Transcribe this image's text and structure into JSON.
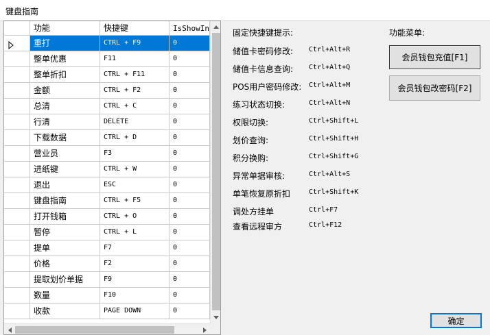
{
  "window": {
    "title": "键盘指南"
  },
  "grid": {
    "columns": [
      "功能",
      "快捷键",
      "IsShowInM"
    ],
    "selected_index": 0,
    "rows": [
      {
        "name": "重打",
        "key": "CTRL + F9",
        "show": "0"
      },
      {
        "name": "整单优惠",
        "key": "F11",
        "show": "0"
      },
      {
        "name": "整单折扣",
        "key": "CTRL + F11",
        "show": "0"
      },
      {
        "name": "金额",
        "key": "CTRL + F2",
        "show": "0"
      },
      {
        "name": "总清",
        "key": "CTRL + C",
        "show": "0"
      },
      {
        "name": "行清",
        "key": "DELETE",
        "show": "0"
      },
      {
        "name": "下载数据",
        "key": "CTRL + D",
        "show": "0"
      },
      {
        "name": "营业员",
        "key": "F3",
        "show": "0"
      },
      {
        "name": "进纸键",
        "key": "CTRL + W",
        "show": "0"
      },
      {
        "name": "退出",
        "key": "ESC",
        "show": "0"
      },
      {
        "name": "键盘指南",
        "key": "CTRL + F5",
        "show": "0"
      },
      {
        "name": "打开钱箱",
        "key": "CTRL + O",
        "show": "0"
      },
      {
        "name": "暂停",
        "key": "CTRL + L",
        "show": "0"
      },
      {
        "name": "提单",
        "key": "F7",
        "show": "0"
      },
      {
        "name": "价格",
        "key": "F2",
        "show": "0"
      },
      {
        "name": "提取划价单据",
        "key": "F9",
        "show": "0"
      },
      {
        "name": "数量",
        "key": "F10",
        "show": "0"
      },
      {
        "name": "收款",
        "key": "PAGE DOWN",
        "show": "0"
      }
    ]
  },
  "hints": {
    "heading": "固定快捷键提示:",
    "items": [
      {
        "label": "储值卡密码修改:",
        "key": "Ctrl+Alt+R"
      },
      {
        "label": "储值卡信息查询:",
        "key": "Ctrl+Alt+Q"
      },
      {
        "label": "POS用户密码修改:",
        "key": "Ctrl+Alt+M"
      },
      {
        "label": "练习状态切换:",
        "key": "Ctrl+Alt+N"
      },
      {
        "label": "权限切换:",
        "key": "Ctrl+Shift+L"
      },
      {
        "label": "划价查询:",
        "key": "Ctrl+Shift+H"
      },
      {
        "label": "积分换购:",
        "key": "Ctrl+Shift+G"
      },
      {
        "label": "异常单据审核:",
        "key": "Ctrl+Alt+S"
      },
      {
        "label": "单笔恢复原折扣",
        "key": "Ctrl+Shift+K"
      },
      {
        "label": "调处方挂单",
        "key": "Ctrl+F7"
      },
      {
        "label": "查看远程审方",
        "key": "Ctrl+F12"
      }
    ]
  },
  "menu": {
    "heading": "功能菜单:",
    "buttons": [
      "会员钱包充值[F1]",
      "会员钱包改密码[F2]"
    ]
  },
  "confirm_label": "确定",
  "colors": {
    "selection": "#0078d7",
    "background": "#f0f0f0"
  }
}
